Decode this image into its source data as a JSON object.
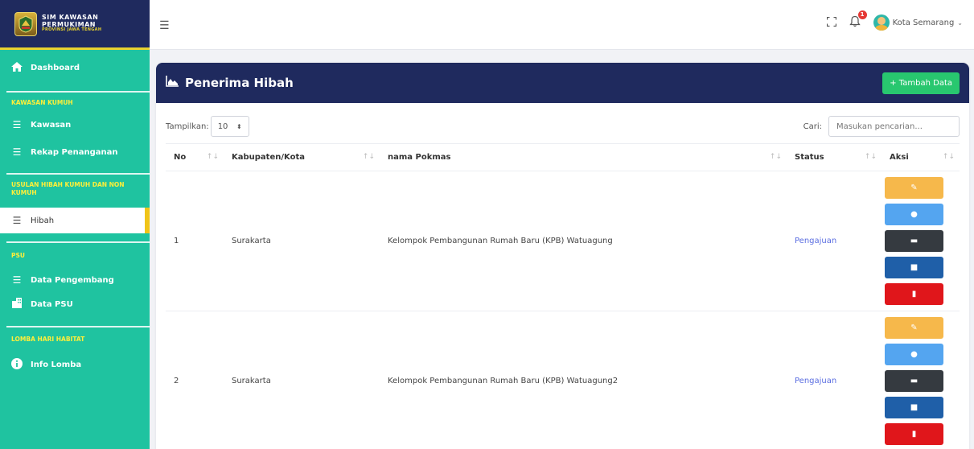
{
  "brand": {
    "line1": "SIM KAWASAN",
    "line2": "PERMUKIMAN",
    "line3": "PROVINSI JAWA TENGAH"
  },
  "sidebar": {
    "dashboard": "Dashboard",
    "section_kumuh": "KAWASAN KUMUH",
    "kawasan": "Kawasan",
    "rekap": "Rekap Penanganan",
    "section_hibah": "USULAN HIBAH KUMUH DAN NON KUMUH",
    "hibah": "Hibah",
    "section_psu": "PSU",
    "data_pengembang": "Data Pengembang",
    "data_psu": "Data PSU",
    "section_lomba": "LOMBA HARI HABITAT",
    "info_lomba": "Info Lomba"
  },
  "topbar": {
    "notification_count": "1",
    "user": "Kota Semarang"
  },
  "card": {
    "title": "Penerima Hibah",
    "add_button": "+ Tambah Data"
  },
  "controls": {
    "show_label": "Tampilkan:",
    "page_size": "10",
    "search_label": "Cari:",
    "search_placeholder": "Masukan pencarian..."
  },
  "table": {
    "headers": [
      "No",
      "Kabupaten/Kota",
      "nama Pokmas",
      "Status",
      "Aksi"
    ],
    "rows": [
      {
        "no": "1",
        "kota": "Surakarta",
        "pokmas": "Kelompok Pembangunan Rumah Baru (KPB) Watuagung",
        "status": "Pengajuan"
      },
      {
        "no": "2",
        "kota": "Surakarta",
        "pokmas": "Kelompok Pembangunan Rumah Baru (KPB) Watuagung2",
        "status": "Pengajuan"
      }
    ]
  },
  "colors": {
    "sidebar": "#1fc3a0",
    "navy": "#1f2a5e",
    "accent_yellow": "#ffef3a",
    "add_green": "#28c76f",
    "edit": "#f6b84b",
    "info": "#54a5f0",
    "dark": "#353a40",
    "blue": "#1f5fa8",
    "delete": "#e0161b",
    "status": "#5b6ee1"
  }
}
